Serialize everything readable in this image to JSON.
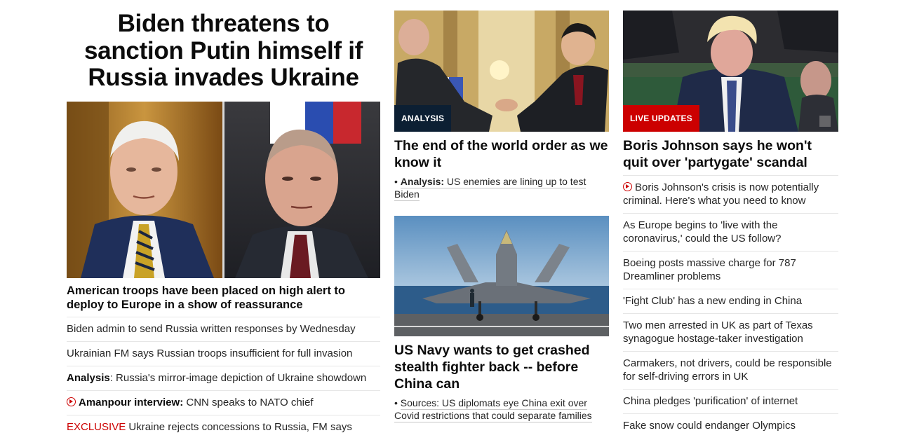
{
  "lead": {
    "headline": "Biden threatens to sanction Putin himself if Russia invades Ukraine",
    "subheadline": "American troops have been placed on high alert to deploy to Europe in a show of reassurance",
    "links": [
      {
        "prefix": "",
        "text": "Biden admin to send Russia written responses by Wednesday"
      },
      {
        "prefix": "",
        "text": "Ukrainian FM says Russian troops insufficient for full invasion"
      },
      {
        "prefix": "Analysis",
        "text": ": Russia's mirror-image depiction of Ukraine showdown"
      },
      {
        "prefix": "Amanpour interview:",
        "text": " CNN speaks to NATO chief"
      },
      {
        "prefix": "EXCLUSIVE",
        "text": " Ukraine rejects concessions to Russia, FM says"
      }
    ]
  },
  "middle": {
    "card1": {
      "badge": "ANALYSIS",
      "title": "The end of the world order as we know it",
      "sub_prefix": "Analysis:",
      "sub_text": " US enemies are lining up to test Biden"
    },
    "card2": {
      "title": "US Navy wants to get crashed stealth fighter back -- before China can",
      "sub_prefix": "Sources:",
      "sub_text": " US diplomats eye China exit over Covid restrictions that could separate families"
    }
  },
  "right": {
    "badge": "LIVE UPDATES",
    "title": "Boris Johnson says he won't quit over 'partygate' scandal",
    "links": [
      "Boris Johnson's crisis is now potentially criminal. Here's what you need to know",
      "As Europe begins to 'live with the coronavirus,' could the US follow?",
      "Boeing posts massive charge for 787 Dreamliner problems",
      "'Fight Club' has a new ending in China",
      "Two men arrested in UK as part of Texas synagogue hostage-taker investigation",
      "Carmakers, not drivers, could be responsible for self-driving errors in UK",
      "China pledges 'purification' of internet",
      "Fake snow could endanger Olympics"
    ]
  },
  "colors": {
    "accent_red": "#cc0000",
    "badge_dark": "#0c1f33"
  }
}
